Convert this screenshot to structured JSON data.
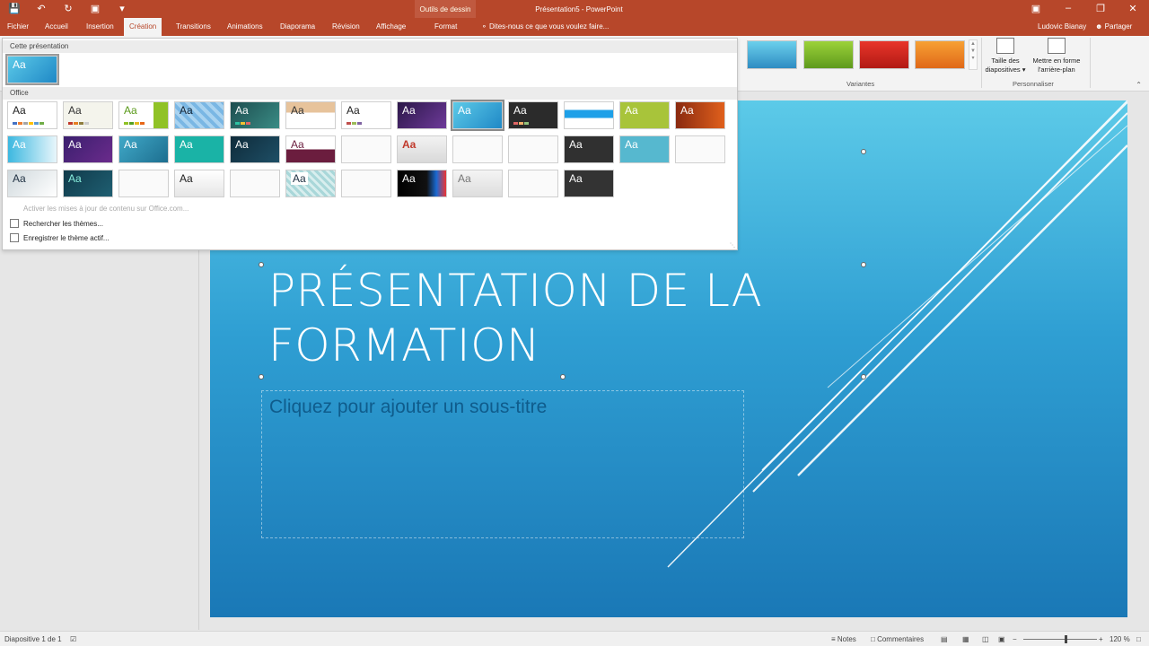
{
  "titlebar": {
    "contextual_tools": "Outils de dessin",
    "title": "Présentation5 - PowerPoint"
  },
  "tabs": [
    {
      "label": "Fichier"
    },
    {
      "label": "Accueil"
    },
    {
      "label": "Insertion"
    },
    {
      "label": "Création"
    },
    {
      "label": "Transitions"
    },
    {
      "label": "Animations"
    },
    {
      "label": "Diaporama"
    },
    {
      "label": "Révision"
    },
    {
      "label": "Affichage"
    },
    {
      "label": "Format"
    }
  ],
  "tell_me": "Dites-nous ce que vous voulez faire...",
  "user": "Ludovic Bianay",
  "share": "Partager",
  "ribbon": {
    "variants_label": "Variantes",
    "personalize_label": "Personnaliser",
    "slide_size_l1": "Taille des",
    "slide_size_l2": "diapositives ▾",
    "format_bg_l1": "Mettre en forme",
    "format_bg_l2": "l'arrière-plan"
  },
  "gallery": {
    "section_current": "Cette présentation",
    "section_office": "Office",
    "tile_text": "Aa",
    "cmd_update": "Activer les mises à jour de contenu sur Office.com...",
    "cmd_browse": "Rechercher les thèmes...",
    "cmd_save": "Enregistrer le thème actif..."
  },
  "slide": {
    "title_line1": "PRÉSENTATION DE LA",
    "title_line2": "FORMATION",
    "subtitle_placeholder": "Cliquez pour ajouter un sous-titre"
  },
  "status": {
    "slide_count": "Diapositive 1 de 1",
    "notes": "Notes",
    "comments": "Commentaires",
    "zoom": "120 %"
  },
  "colors": {
    "accent": "#b7472a",
    "slide_top": "#5ccae8",
    "slide_bottom": "#1a78b6"
  }
}
